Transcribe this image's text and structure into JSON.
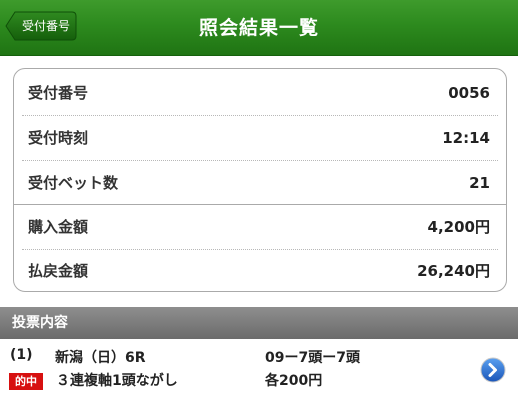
{
  "header": {
    "title": "照会結果一覧",
    "back_label": "受付番号"
  },
  "summary": {
    "rows": [
      {
        "label": "受付番号",
        "value": "0056"
      },
      {
        "label": "受付時刻",
        "value": "12:14"
      },
      {
        "label": "受付ベット数",
        "value": "21"
      },
      {
        "label": "購入金額",
        "value": "4,200円"
      },
      {
        "label": "払戻金額",
        "value": "26,240円"
      }
    ]
  },
  "section": {
    "title": "投票内容"
  },
  "bets": [
    {
      "index": "(1)",
      "race": "新潟（日）6R",
      "combination": "09ー7頭ー7頭",
      "status_badge": "的中",
      "bet_type": "３連複軸1頭ながし",
      "amount": "各200円"
    }
  ],
  "colors": {
    "header_green": "#2d8a1e",
    "section_gray": "#7a7a7a",
    "hit_red": "#d71010",
    "detail_blue": "#1f64c8"
  }
}
